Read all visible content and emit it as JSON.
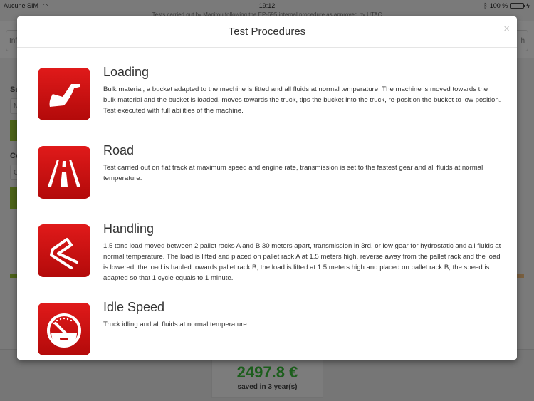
{
  "status_bar": {
    "carrier": "Aucune SIM",
    "time": "19:12",
    "battery": "100 %",
    "battery_level_percent": 100
  },
  "background": {
    "banner": "Tests carried out by Manitou following the EP-695 internal procedure as approved by UTAC",
    "left_select": "Inf",
    "right_select": "h",
    "label_1": "Se",
    "input_1": "M",
    "label_2": "Co",
    "input_2": "C",
    "savings_amount": "2497.8 €",
    "savings_caption": "saved in 3 year(s)"
  },
  "modal": {
    "title": "Test Procedures",
    "close_label": "×",
    "procedures": [
      {
        "icon": "loader-bucket-icon",
        "title": "Loading",
        "description": "Bulk material, a bucket adapted to the machine is fitted and all fluids at normal temperature. The machine is moved towards the bulk material and the bucket is loaded, moves towards the truck, tips the bucket into the truck, re-position the bucket to low position. Test executed with full abilities of the machine."
      },
      {
        "icon": "road-icon",
        "title": "Road",
        "description": "Test carried out on flat track at maximum speed and engine rate, transmission is set to the fastest gear and all fluids at normal temperature."
      },
      {
        "icon": "forklift-forks-icon",
        "title": "Handling",
        "description": "1.5 tons load moved between 2 pallet racks A and B 30 meters apart, transmission in 3rd, or low gear for hydrostatic and all fluids at normal temperature. The load is lifted and placed on pallet rack A at 1.5 meters high, reverse away from the pallet rack and the load is lowered, the load is hauled towards pallet rack B, the load is lifted at 1.5 meters high and placed on pallet rack B, the speed is adapted so that 1 cycle equals to 1 minute."
      },
      {
        "icon": "speedometer-icon",
        "title": "Idle Speed",
        "description": "Truck idling and all fluids at normal temperature."
      }
    ]
  },
  "colors": {
    "icon_red": "#d01414",
    "savings_green": "#1c5e1c",
    "bg_button_green": "#4d6419"
  }
}
